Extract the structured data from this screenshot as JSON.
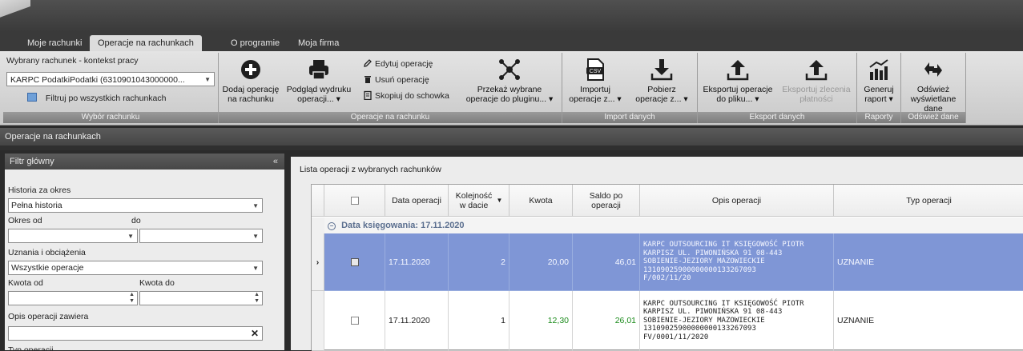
{
  "app": {
    "tabs": [
      {
        "label": "Moje rachunki"
      },
      {
        "label": "Operacje na rachunkach"
      },
      {
        "label": "O programie"
      },
      {
        "label": "Moja firma"
      }
    ]
  },
  "ribbon": {
    "context": {
      "title": "Wybrany rachunek - kontekst pracy",
      "account": "KARPC PodatkiPodatki (6310901043000000...",
      "filter_all": "Filtruj po wszystkich rachunkach",
      "caption": "Wybór rachunku"
    },
    "operations": {
      "add": "Dodaj operację na rachunku",
      "add_l1": "Dodaj operację",
      "add_l2": "na rachunku",
      "print_l1": "Podgląd wydruku",
      "print_l2": "operacji... ▾",
      "edit": "Edytuj operację",
      "delete": "Usuń operację",
      "copy": "Skopiuj do schowka",
      "plugin_l1": "Przekaż wybrane",
      "plugin_l2": "operacje do pluginu... ▾",
      "caption": "Operacje na rachunku"
    },
    "import": {
      "import_l1": "Importuj",
      "import_l2": "operacje z... ▾",
      "fetch_l1": "Pobierz",
      "fetch_l2": "operacje z... ▾",
      "caption": "Import danych"
    },
    "export": {
      "export_l1": "Eksportuj operacje",
      "export_l2": "do pliku... ▾",
      "orders_l1": "Eksportuj zlecenia",
      "orders_l2": "płatności",
      "caption": "Eksport danych"
    },
    "reports": {
      "gen_l1": "Generuj",
      "gen_l2": "raport ▾",
      "caption": "Raporty"
    },
    "refresh": {
      "l1": "Odśwież",
      "l2": "wyświetlane dane",
      "caption": "Odśwież dane"
    }
  },
  "section_title": "Operacje na rachunkach",
  "filter": {
    "title": "Filtr główny",
    "collapse": "«",
    "history_label": "Historia za okres",
    "history_value": "Pełna historia",
    "from_label": "Okres od",
    "to_label": "do",
    "credits_label": "Uznania i obciążenia",
    "credits_value": "Wszystkie operacje",
    "amount_from_label": "Kwota od",
    "amount_to_label": "Kwota do",
    "desc_label": "Opis operacji zawiera",
    "type_label": "Typ operacji"
  },
  "list": {
    "caption": "Lista operacji z wybranych rachunków",
    "columns": {
      "date": "Data operacji",
      "order": "Kolejność w dacie",
      "amount": "Kwota",
      "balance": "Saldo po operacji",
      "desc": "Opis operacji",
      "type": "Typ operacji"
    },
    "group_label": "Data księgowania: 17.11.2020",
    "rows": [
      {
        "date": "17.11.2020",
        "order": "2",
        "amount": "20,00",
        "balance": "46,01",
        "desc1": "KARPC OUTSOURCING IT KSIĘGOWOŚĆ PIOTR",
        "desc2": "KARPISZ UL. PIWONIŃSKA 91 08-443",
        "desc3": "SOBIENIE-JEZIORY MAZOWIECKIE",
        "desc4": "13109025900000000133267093",
        "desc5": "F/002/11/20",
        "type": "UZNANIE"
      },
      {
        "date": "17.11.2020",
        "order": "1",
        "amount": "12,30",
        "balance": "26,01",
        "desc1": "KARPC OUTSOURCING IT KSIĘGOWOŚĆ PIOTR",
        "desc2": "KARPISZ UL. PIWONIŃSKA 91 08-443",
        "desc3": "SOBIENIE-JEZIORY MAZOWIECKIE",
        "desc4": "13109025900000000133267093",
        "desc5": "FV/0001/11/2020",
        "type": "UZNANIE"
      }
    ]
  }
}
